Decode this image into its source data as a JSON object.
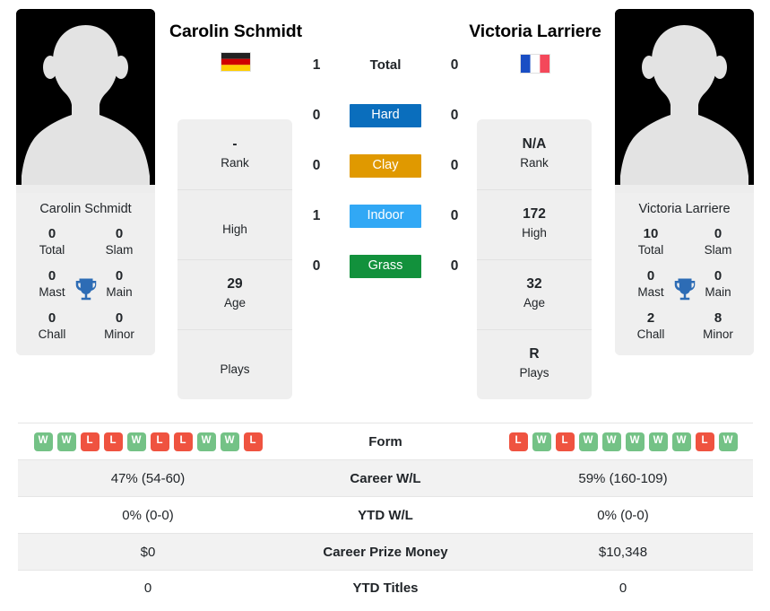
{
  "players": {
    "left": {
      "name": "Carolin Schmidt",
      "photo_caption": "Carolin Schmidt",
      "country_flag": "germany-flag",
      "titles": {
        "total": "0",
        "total_label": "Total",
        "slam": "0",
        "slam_label": "Slam",
        "mast": "0",
        "mast_label": "Mast",
        "main": "0",
        "main_label": "Main",
        "chall": "0",
        "chall_label": "Chall",
        "minor": "0",
        "minor_label": "Minor"
      },
      "info": {
        "rank": "-",
        "rank_label": "Rank",
        "high": "",
        "high_label": "High",
        "age": "29",
        "age_label": "Age",
        "plays": "",
        "plays_label": "Plays"
      },
      "form": [
        "W",
        "W",
        "L",
        "L",
        "W",
        "L",
        "L",
        "W",
        "W",
        "L"
      ],
      "career_wl": "47% (54-60)",
      "ytd_wl": "0% (0-0)",
      "career_prize_money": "$0",
      "ytd_titles": "0"
    },
    "right": {
      "name": "Victoria Larriere",
      "photo_caption": "Victoria Larriere",
      "country_flag": "france-flag",
      "titles": {
        "total": "10",
        "total_label": "Total",
        "slam": "0",
        "slam_label": "Slam",
        "mast": "0",
        "mast_label": "Mast",
        "main": "0",
        "main_label": "Main",
        "chall": "2",
        "chall_label": "Chall",
        "minor": "8",
        "minor_label": "Minor"
      },
      "info": {
        "rank": "N/A",
        "rank_label": "Rank",
        "high": "172",
        "high_label": "High",
        "age": "32",
        "age_label": "Age",
        "plays": "R",
        "plays_label": "Plays"
      },
      "form": [
        "L",
        "W",
        "L",
        "W",
        "W",
        "W",
        "W",
        "W",
        "L",
        "W"
      ],
      "career_wl": "59% (160-109)",
      "ytd_wl": "0% (0-0)",
      "career_prize_money": "$10,348",
      "ytd_titles": "0"
    }
  },
  "head_to_head": [
    {
      "left": "1",
      "label": "Total",
      "right": "0",
      "style": "plain"
    },
    {
      "left": "0",
      "label": "Hard",
      "right": "0",
      "style": "badge",
      "color": "#0a6ebd"
    },
    {
      "left": "0",
      "label": "Clay",
      "right": "0",
      "style": "badge",
      "color": "#e09900"
    },
    {
      "left": "1",
      "label": "Indoor",
      "right": "0",
      "style": "badge",
      "color": "#31a8f5"
    },
    {
      "left": "0",
      "label": "Grass",
      "right": "0",
      "style": "badge",
      "color": "#12913c"
    }
  ],
  "comparison_rows": [
    {
      "label": "Form",
      "left": "",
      "right": "",
      "kind": "form",
      "shade": false
    },
    {
      "label": "Career W/L",
      "left": "47% (54-60)",
      "right": "59% (160-109)",
      "kind": "text",
      "shade": true
    },
    {
      "label": "YTD W/L",
      "left": "0% (0-0)",
      "right": "0% (0-0)",
      "kind": "text",
      "shade": false
    },
    {
      "label": "Career Prize Money",
      "left": "$0",
      "right": "$10,348",
      "kind": "text",
      "shade": true
    },
    {
      "label": "YTD Titles",
      "left": "0",
      "right": "0",
      "kind": "text",
      "shade": false
    }
  ],
  "colors": {
    "hard": "#0a6ebd",
    "clay": "#e09900",
    "indoor": "#31a8f5",
    "grass": "#12913c",
    "win_badge": "#74c286",
    "loss_badge": "#ef5340",
    "card_bg": "#efefef",
    "row_shade": "#f2f2f2",
    "trophy": "#2d6cb5"
  },
  "icons": {
    "trophy": "trophy-icon",
    "avatar": "avatar-silhouette-icon"
  }
}
